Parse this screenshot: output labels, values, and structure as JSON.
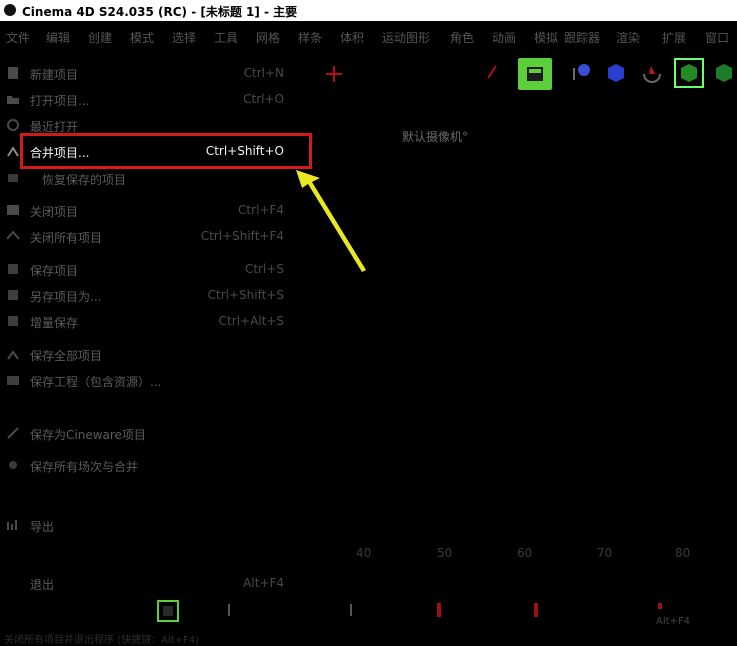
{
  "window": {
    "title": "Cinema 4D S24.035 (RC) - [未标题 1] - 主要"
  },
  "menubar": {
    "items": [
      "文件",
      "编辑",
      "创建",
      "模式",
      "选择",
      "工具",
      "网格",
      "样条",
      "体积",
      "运动图形",
      "角色",
      "动画",
      "模拟",
      "跟踪器",
      "渲染",
      "扩展",
      "窗口"
    ]
  },
  "file_menu": {
    "items": [
      {
        "label": "新建项目",
        "shortcut": "Ctrl+N",
        "icon": "new-project-icon"
      },
      {
        "label": "打开项目...",
        "shortcut": "Ctrl+O",
        "icon": "open-folder-icon"
      },
      {
        "label": "最近打开",
        "shortcut": "",
        "icon": "recent-icon"
      },
      {
        "label": "合并项目...",
        "shortcut": "Ctrl+Shift+O",
        "icon": "merge-icon"
      },
      {
        "label": "恢复保存的项目",
        "shortcut": "",
        "icon": "revert-icon"
      },
      {
        "label": "关闭项目",
        "shortcut": "Ctrl+F4",
        "icon": "close-project-icon"
      },
      {
        "label": "关闭所有项目",
        "shortcut": "Ctrl+Shift+F4",
        "icon": "close-all-icon"
      },
      {
        "label": "保存项目",
        "shortcut": "Ctrl+S",
        "icon": "save-icon"
      },
      {
        "label": "另存项目为...",
        "shortcut": "Ctrl+Shift+S",
        "icon": "save-as-icon"
      },
      {
        "label": "增量保存",
        "shortcut": "Ctrl+Alt+S",
        "icon": "incremental-save-icon"
      },
      {
        "label": "保存全部项目",
        "shortcut": "",
        "icon": "save-all-icon"
      },
      {
        "label": "保存工程（包含资源）...",
        "shortcut": "",
        "icon": "save-with-assets-icon"
      },
      {
        "label": "保存为Cineware项目",
        "shortcut": "",
        "icon": "cineware-icon"
      },
      {
        "label": "保存所有场次与合并",
        "shortcut": "",
        "icon": "takes-icon"
      },
      {
        "label": "导出",
        "shortcut": "",
        "icon": "export-icon"
      },
      {
        "label": "退出",
        "shortcut": "Alt+F4",
        "icon": "exit-icon"
      }
    ]
  },
  "viewport": {
    "camera_label": "默认摄像机°"
  },
  "timeline": {
    "ticks": [
      "40",
      "50",
      "60",
      "70",
      "80"
    ]
  },
  "status": {
    "text": "关闭所有项目并退出程序 (快捷键：Alt+F4)",
    "shortcut_right": "Alt+F4"
  },
  "colors": {
    "highlight": "#d11a1a",
    "arrow": "#e8e820",
    "accent_green": "#5ccf3a"
  }
}
